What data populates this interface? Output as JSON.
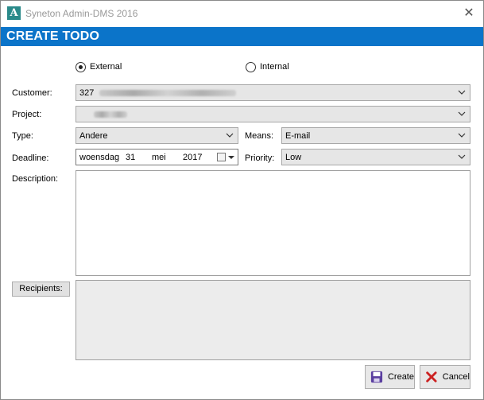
{
  "window": {
    "title": "Syneton Admin-DMS 2016",
    "close_glyph": "✕"
  },
  "header": {
    "title": "CREATE TODO"
  },
  "radios": [
    {
      "label": "External",
      "selected": true
    },
    {
      "label": "Internal",
      "selected": false
    }
  ],
  "form": {
    "customer": {
      "label": "Customer:",
      "value_prefix": "327"
    },
    "project": {
      "label": "Project:"
    },
    "type": {
      "label": "Type:",
      "value": "Andere"
    },
    "means": {
      "label": "Means:",
      "value": "E-mail"
    },
    "deadline": {
      "label": "Deadline:",
      "weekday": "woensdag",
      "day": "31",
      "month": "mei",
      "year": "2017"
    },
    "priority": {
      "label": "Priority:",
      "value": "Low"
    },
    "description": {
      "label": "Description:",
      "value": ""
    },
    "recipients": {
      "button_label": "Recipients:"
    }
  },
  "buttons": {
    "create": "Create",
    "cancel": "Cancel"
  },
  "colors": {
    "header_bg": "#0b74c9",
    "cancel_icon": "#cc2222",
    "create_icon": "#5b3fa0"
  }
}
